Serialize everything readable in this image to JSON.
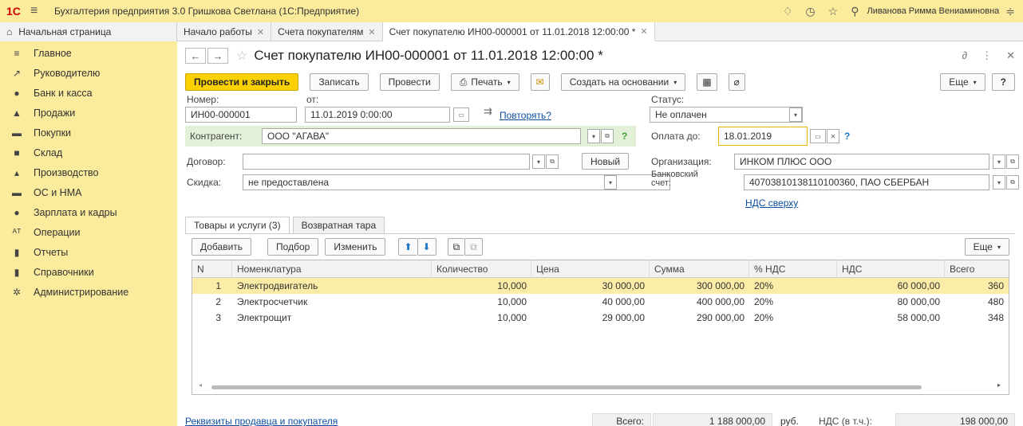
{
  "titlebar": {
    "logo": "1С",
    "title": "Бухгалтерия предприятия 3.0 Гришкова Светлана  (1С:Предприятие)",
    "user": "Ливанова Римма Вениаминовна"
  },
  "tabs": {
    "home": "Начальная страница",
    "items": [
      {
        "label": "Начало работы"
      },
      {
        "label": "Счета покупателям"
      },
      {
        "label": "Счет покупателю ИН00-000001 от 11.01.2018 12:00:00 *"
      }
    ]
  },
  "sidebar": {
    "items": [
      {
        "label": "Главное",
        "icon": "≡"
      },
      {
        "label": "Руководителю",
        "icon": "↗"
      },
      {
        "label": "Банк и касса",
        "icon": "●"
      },
      {
        "label": "Продажи",
        "icon": "▲"
      },
      {
        "label": "Покупки",
        "icon": "▬"
      },
      {
        "label": "Склад",
        "icon": "■"
      },
      {
        "label": "Производство",
        "icon": "▴"
      },
      {
        "label": "ОС и НМА",
        "icon": "▬"
      },
      {
        "label": "Зарплата и кадры",
        "icon": "●"
      },
      {
        "label": "Операции",
        "icon": "ᴬᵀ"
      },
      {
        "label": "Отчеты",
        "icon": "▮"
      },
      {
        "label": "Справочники",
        "icon": "▮"
      },
      {
        "label": "Администрирование",
        "icon": "✲"
      }
    ]
  },
  "document": {
    "title": "Счет покупателю ИН00-000001 от 11.01.2018 12:00:00 *"
  },
  "toolbar": {
    "post_close": "Провести и закрыть",
    "save": "Записать",
    "post": "Провести",
    "print": "Печать",
    "create_based": "Создать на основании",
    "more": "Еще",
    "help": "?"
  },
  "form": {
    "number_label": "Номер:",
    "number_value": "ИН00-000001",
    "from_label": "от:",
    "date_value": "11.01.2019  0:00:00",
    "repeat_link": "Повторять?",
    "status_label": "Статус:",
    "status_value": "Не оплачен",
    "counterparty_label": "Контрагент:",
    "counterparty_value": "ООО \"АГАВА\"",
    "pay_until_label": "Оплата до:",
    "pay_until_value": "18.01.2019",
    "contract_label": "Договор:",
    "contract_value": "",
    "new_button": "Новый",
    "org_label": "Организация:",
    "org_value": "ИНКОМ ПЛЮС ООО",
    "discount_label": "Скидка:",
    "discount_value": "не предоставлена",
    "bank_label": "Банковский счет:",
    "bank_value": "40703810138110100360, ПАО СБЕРБАН",
    "vat_link": "НДС сверху"
  },
  "inner_tabs": [
    {
      "label": "Товары и услуги (3)"
    },
    {
      "label": "Возвратная тара"
    }
  ],
  "table_toolbar": {
    "add": "Добавить",
    "pick": "Подбор",
    "change": "Изменить",
    "more": "Еще"
  },
  "table": {
    "columns": [
      "N",
      "Номенклатура",
      "Количество",
      "Цена",
      "Сумма",
      "% НДС",
      "НДС",
      "Всего"
    ],
    "rows": [
      [
        "1",
        "Электродвигатель",
        "10,000",
        "30 000,00",
        "300 000,00",
        "20%",
        "60 000,00",
        "360"
      ],
      [
        "2",
        "Электросчетчик",
        "10,000",
        "40 000,00",
        "400 000,00",
        "20%",
        "80 000,00",
        "480"
      ],
      [
        "3",
        "Электрощит",
        "10,000",
        "29 000,00",
        "290 000,00",
        "20%",
        "58 000,00",
        "348"
      ]
    ]
  },
  "footer": {
    "requisites_link": "Реквизиты продавца и покупателя",
    "total_label": "Всего:",
    "total_value": "1 188 000,00",
    "currency": "руб.",
    "vat_label": "НДС (в т.ч.):",
    "vat_value": "198 000,00"
  }
}
